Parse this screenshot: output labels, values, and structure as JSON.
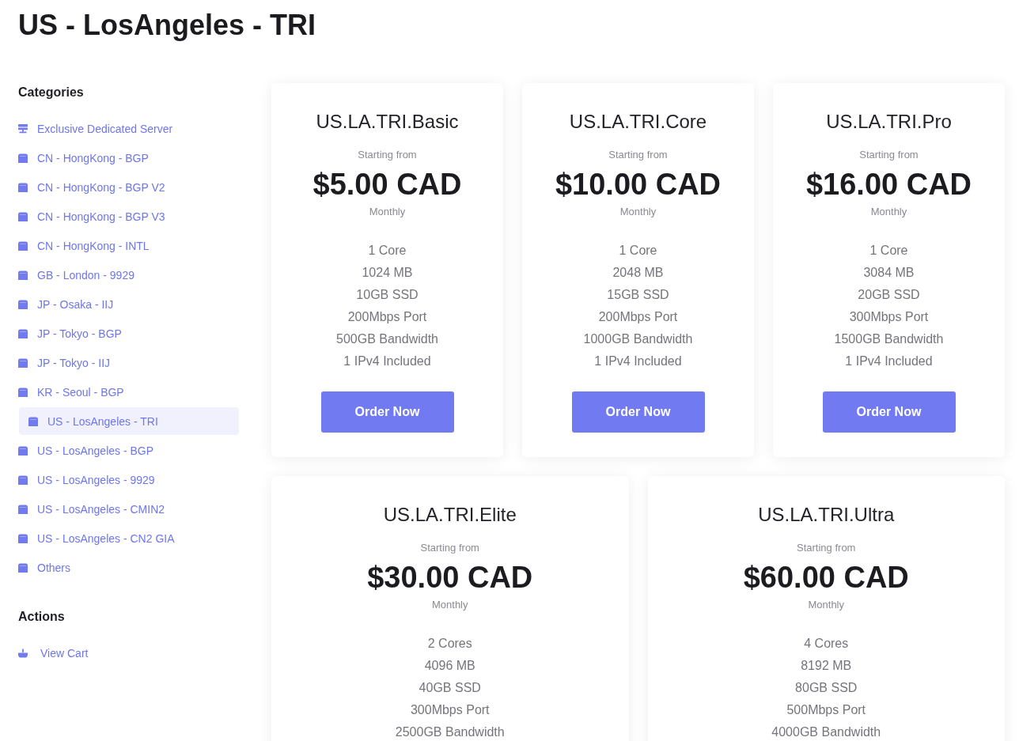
{
  "page_title": "US - LosAngeles - TRI",
  "sidebar": {
    "sections": [
      {
        "heading": "Categories",
        "items": [
          {
            "label": "Exclusive Dedicated Server",
            "kind": "server",
            "selected": false
          },
          {
            "label": "CN - HongKong - BGP",
            "kind": "box",
            "selected": false
          },
          {
            "label": "CN - HongKong - BGP V2",
            "kind": "box",
            "selected": false
          },
          {
            "label": "CN - HongKong - BGP V3",
            "kind": "box",
            "selected": false
          },
          {
            "label": "CN - HongKong - INTL",
            "kind": "box",
            "selected": false
          },
          {
            "label": "GB - London - 9929",
            "kind": "box",
            "selected": false
          },
          {
            "label": "JP - Osaka - IIJ",
            "kind": "box",
            "selected": false
          },
          {
            "label": "JP - Tokyo - BGP",
            "kind": "box",
            "selected": false
          },
          {
            "label": "JP - Tokyo - IIJ",
            "kind": "box",
            "selected": false
          },
          {
            "label": "KR - Seoul - BGP",
            "kind": "box",
            "selected": false
          },
          {
            "label": "US - LosAngeles - TRI",
            "kind": "box",
            "selected": true
          },
          {
            "label": "US - LosAngeles - BGP",
            "kind": "box",
            "selected": false
          },
          {
            "label": "US - LosAngeles - 9929",
            "kind": "box",
            "selected": false
          },
          {
            "label": "US - LosAngeles - CMIN2",
            "kind": "box",
            "selected": false
          },
          {
            "label": "US - LosAngeles - CN2 GIA",
            "kind": "box",
            "selected": false
          },
          {
            "label": "Others",
            "kind": "box",
            "selected": false
          }
        ]
      },
      {
        "heading": "Actions",
        "items": [
          {
            "label": "View Cart",
            "kind": "basket",
            "selected": false
          }
        ]
      }
    ]
  },
  "product_rows": [
    {
      "products": [
        {
          "name": "US.LA.TRI.Basic",
          "price_caption": "Starting from",
          "price": "$5.00 CAD",
          "cycle": "Monthly",
          "features": [
            "1 Core",
            "1024 MB",
            "10GB SSD",
            "200Mbps Port",
            "500GB Bandwidth",
            "1 IPv4 Included"
          ],
          "button": "Order Now"
        },
        {
          "name": "US.LA.TRI.Core",
          "price_caption": "Starting from",
          "price": "$10.00 CAD",
          "cycle": "Monthly",
          "features": [
            "1 Core",
            "2048 MB",
            "15GB SSD",
            "200Mbps Port",
            "1000GB Bandwidth",
            "1 IPv4 Included"
          ],
          "button": "Order Now"
        },
        {
          "name": "US.LA.TRI.Pro",
          "price_caption": "Starting from",
          "price": "$16.00 CAD",
          "cycle": "Monthly",
          "features": [
            "1 Core",
            "3084 MB",
            "20GB SSD",
            "300Mbps Port",
            "1500GB Bandwidth",
            "1 IPv4 Included"
          ],
          "button": "Order Now"
        }
      ]
    },
    {
      "products": [
        {
          "name": "US.LA.TRI.Elite",
          "price_caption": "Starting from",
          "price": "$30.00 CAD",
          "cycle": "Monthly",
          "features": [
            "2 Cores",
            "4096 MB",
            "40GB SSD",
            "300Mbps Port",
            "2500GB Bandwidth"
          ]
        },
        {
          "name": "US.LA.TRI.Ultra",
          "price_caption": "Starting from",
          "price": "$60.00 CAD",
          "cycle": "Monthly",
          "features": [
            "4 Cores",
            "8192 MB",
            "80GB SSD",
            "500Mbps Port",
            "4000GB Bandwidth"
          ]
        }
      ]
    }
  ]
}
